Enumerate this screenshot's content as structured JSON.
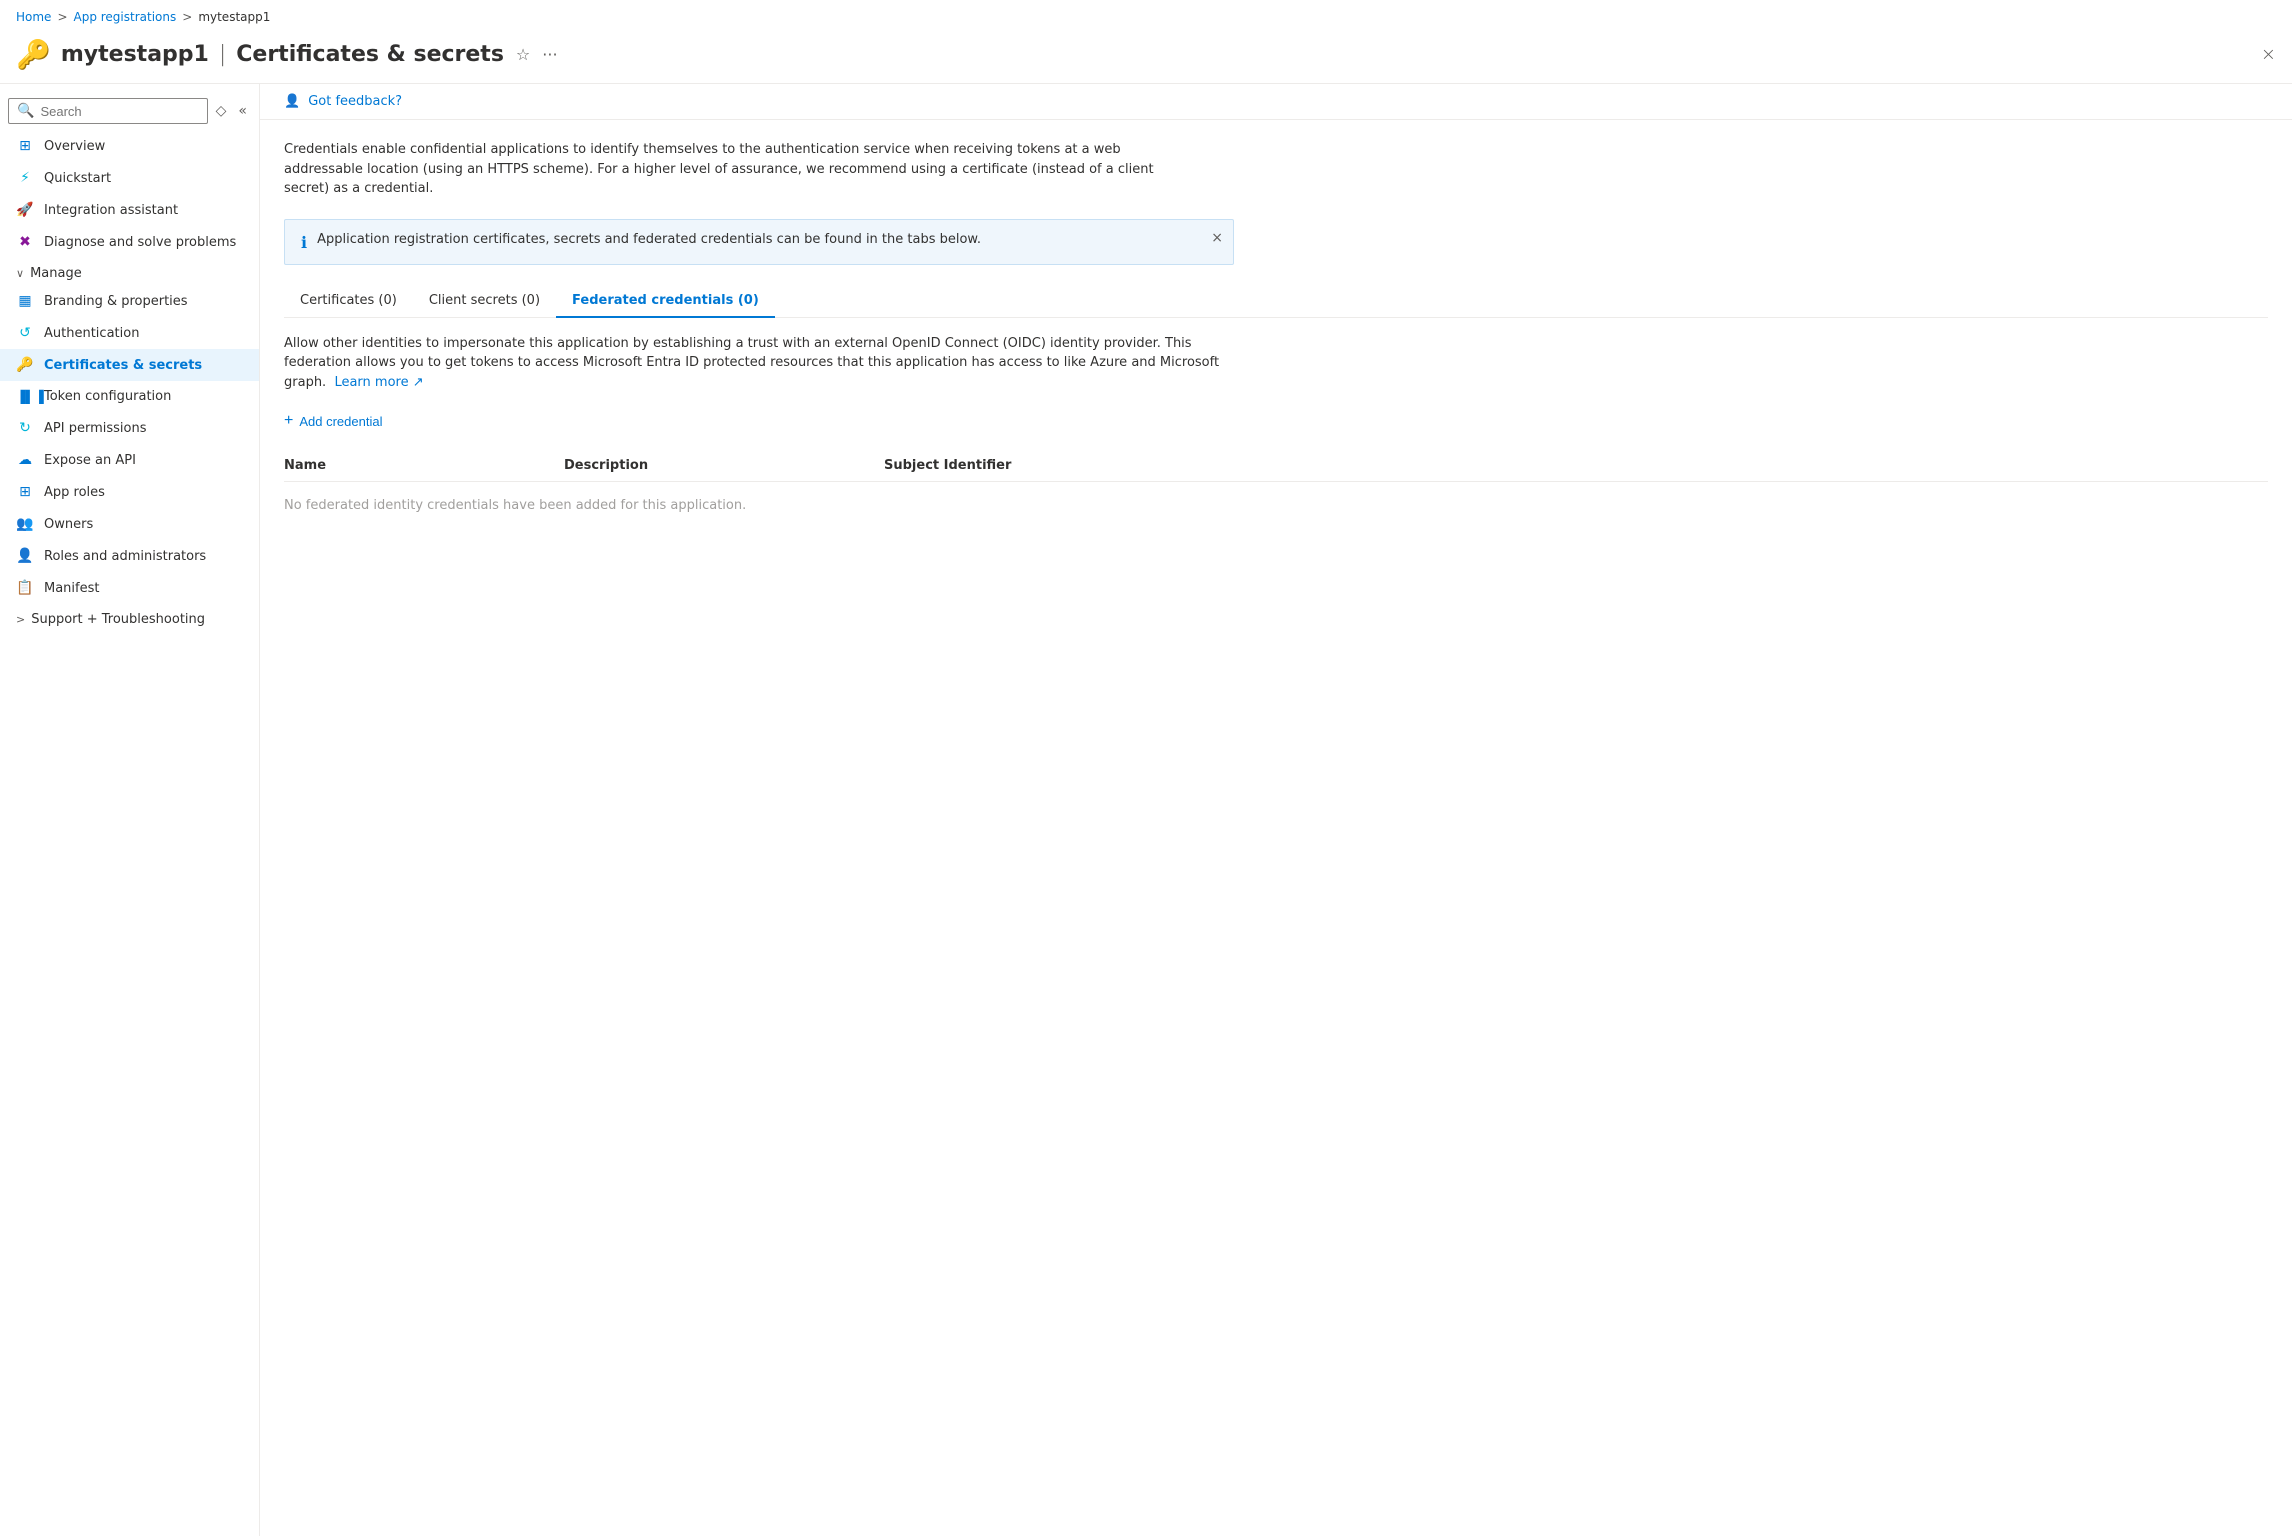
{
  "breadcrumb": {
    "items": [
      "Home",
      "App registrations",
      "mytestapp1"
    ],
    "separators": [
      ">",
      ">"
    ]
  },
  "title": {
    "app_name": "mytestapp1",
    "separator": "|",
    "page_name": "Certificates & secrets",
    "icon": "🔑"
  },
  "toolbar": {
    "pin_tooltip": "Pin",
    "more_tooltip": "More options",
    "close_label": "×"
  },
  "sidebar": {
    "search_placeholder": "Search",
    "items": [
      {
        "id": "overview",
        "label": "Overview",
        "icon": "⊞"
      },
      {
        "id": "quickstart",
        "label": "Quickstart",
        "icon": "⚡"
      },
      {
        "id": "integration-assistant",
        "label": "Integration assistant",
        "icon": "🚀"
      },
      {
        "id": "diagnose",
        "label": "Diagnose and solve problems",
        "icon": "✖"
      }
    ],
    "manage_section": "Manage",
    "manage_items": [
      {
        "id": "branding",
        "label": "Branding & properties",
        "icon": "▦"
      },
      {
        "id": "authentication",
        "label": "Authentication",
        "icon": "↺"
      },
      {
        "id": "certificates",
        "label": "Certificates & secrets",
        "icon": "🔑",
        "active": true
      },
      {
        "id": "token",
        "label": "Token configuration",
        "icon": "▐▐▐"
      },
      {
        "id": "api-permissions",
        "label": "API permissions",
        "icon": "↻"
      },
      {
        "id": "expose-api",
        "label": "Expose an API",
        "icon": "☁"
      },
      {
        "id": "app-roles",
        "label": "App roles",
        "icon": "⊞"
      },
      {
        "id": "owners",
        "label": "Owners",
        "icon": "👥"
      },
      {
        "id": "roles-admin",
        "label": "Roles and administrators",
        "icon": "👤"
      },
      {
        "id": "manifest",
        "label": "Manifest",
        "icon": "📋"
      }
    ],
    "support_section": "Support + Troubleshooting"
  },
  "feedback": {
    "icon": "💬",
    "text": "Got feedback?"
  },
  "description": "Credentials enable confidential applications to identify themselves to the authentication service when receiving tokens at a web addressable location (using an HTTPS scheme). For a higher level of assurance, we recommend using a certificate (instead of a client secret) as a credential.",
  "banner": {
    "text": "Application registration certificates, secrets and federated credentials can be found in the tabs below."
  },
  "tabs": [
    {
      "id": "certificates",
      "label": "Certificates (0)",
      "active": false
    },
    {
      "id": "client-secrets",
      "label": "Client secrets (0)",
      "active": false
    },
    {
      "id": "federated",
      "label": "Federated credentials (0)",
      "active": true
    }
  ],
  "federated": {
    "description": "Allow other identities to impersonate this application by establishing a trust with an external OpenID Connect (OIDC) identity provider. This federation allows you to get tokens to access Microsoft Entra ID protected resources that this application has access to like Azure and Microsoft graph.",
    "learn_more": "Learn more",
    "add_btn": "Add credential",
    "table_headers": [
      "Name",
      "Description",
      "Subject Identifier"
    ],
    "empty_message": "No federated identity credentials have been added for this application."
  }
}
